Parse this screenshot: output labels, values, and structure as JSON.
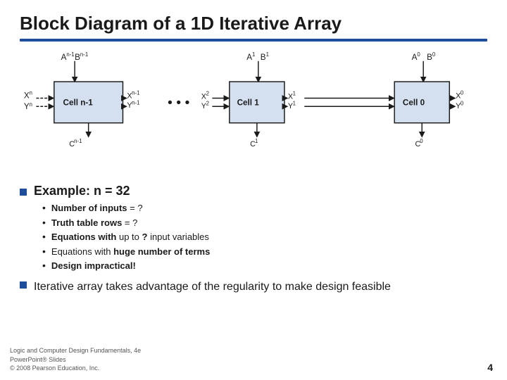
{
  "slide": {
    "title": "Block Diagram of a 1D Iterative Array",
    "example_label": "Example: n = 32",
    "bullets": [
      {
        "text": "Number of inputs = ?"
      },
      {
        "text": "Truth table rows =  ?"
      },
      {
        "text": "Equations with  up to ?  input variables"
      },
      {
        "text": "Equations with huge number of terms"
      },
      {
        "text": "Design impractical!"
      }
    ],
    "bottom_bullet": "Iterative array takes advantage of the regularity to make design feasible",
    "footer_line1": "Logic and Computer Design Fundamentals, 4e",
    "footer_line2": "PowerPoint® Slides",
    "footer_line3": "© 2008 Pearson Education, Inc.",
    "page_number": "4"
  }
}
